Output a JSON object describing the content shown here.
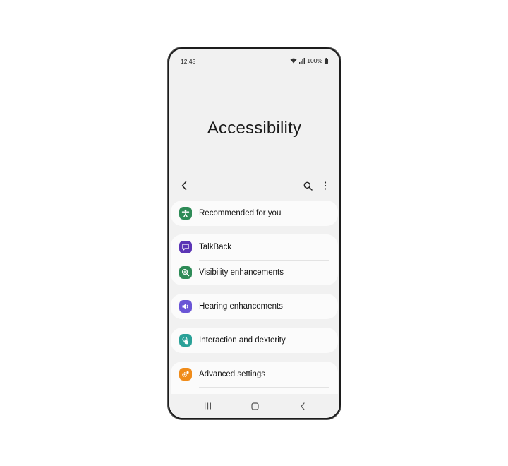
{
  "status_bar": {
    "time": "12:45",
    "battery": "100%"
  },
  "page_title": "Accessibility",
  "toolbar": {
    "back_icon": "chevron-left-icon",
    "search_icon": "search-icon",
    "more_icon": "more-vertical-icon"
  },
  "menu": {
    "recommended": {
      "label": "Recommended for you",
      "icon": "accessibility-person-icon",
      "color": "#2e8b57"
    },
    "talkback": {
      "label": "TalkBack",
      "icon": "talkback-icon",
      "color": "#5b35b5"
    },
    "visibility": {
      "label": "Visibility enhancements",
      "icon": "magnifier-icon",
      "color": "#2e8b57"
    },
    "hearing": {
      "label": "Hearing enhancements",
      "icon": "speaker-icon",
      "color": "#6a55d6"
    },
    "interaction": {
      "label": "Interaction and dexterity",
      "icon": "touch-icon",
      "color": "#2aa198"
    },
    "advanced": {
      "label": "Advanced settings",
      "icon": "gears-icon",
      "color": "#f08c1a"
    }
  },
  "nav_bar": {
    "recent_icon": "recent-apps-icon",
    "home_icon": "home-icon",
    "back_icon": "back-icon"
  }
}
